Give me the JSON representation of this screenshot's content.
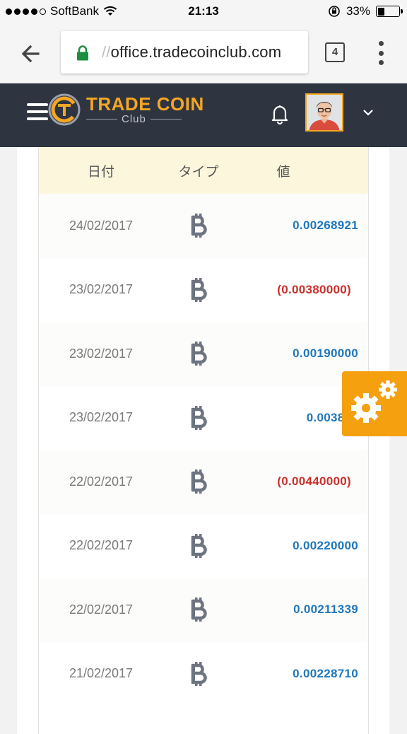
{
  "status_bar": {
    "carrier": "SoftBank",
    "time": "21:13",
    "battery": "33%",
    "battery_level": 0.33,
    "signal_dots_filled": 4
  },
  "browser": {
    "url_faded": "//",
    "url_main": "office.tradecoinclub.com",
    "tab_count": "4"
  },
  "header": {
    "brand_main": "TRADE COIN",
    "brand_sub": "Club"
  },
  "table": {
    "headers": {
      "date": "日付",
      "type": "タイプ",
      "value": "値"
    },
    "rows": [
      {
        "date": "24/02/2017",
        "type_icon": "bitcoin-icon",
        "value": "0.00268921",
        "negative": false
      },
      {
        "date": "23/02/2017",
        "type_icon": "bitcoin-icon",
        "value": "(0.00380000)",
        "negative": true
      },
      {
        "date": "23/02/2017",
        "type_icon": "bitcoin-icon",
        "value": "0.00190000",
        "negative": false
      },
      {
        "date": "23/02/2017",
        "type_icon": "bitcoin-icon",
        "value": "0.003812",
        "negative": false
      },
      {
        "date": "22/02/2017",
        "type_icon": "bitcoin-icon",
        "value": "(0.00440000)",
        "negative": true
      },
      {
        "date": "22/02/2017",
        "type_icon": "bitcoin-icon",
        "value": "0.00220000",
        "negative": false
      },
      {
        "date": "22/02/2017",
        "type_icon": "bitcoin-icon",
        "value": "0.00211339",
        "negative": false
      },
      {
        "date": "21/02/2017",
        "type_icon": "bitcoin-icon",
        "value": "0.00228710",
        "negative": false
      }
    ]
  },
  "colors": {
    "header_bg": "#2e3541",
    "brand_accent": "#f5a623",
    "positive_value": "#1f77bb",
    "negative_value": "#c9302c",
    "table_header_bg": "#fcf6dc",
    "fab_bg": "#f5a00f"
  }
}
